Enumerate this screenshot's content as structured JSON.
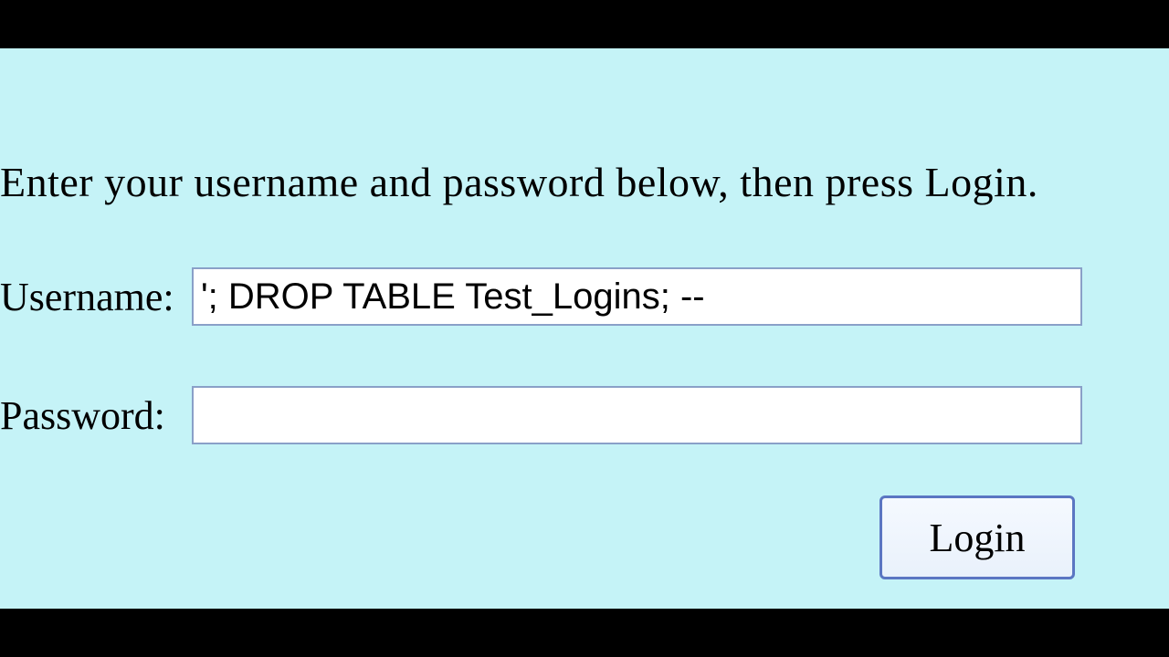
{
  "instruction": "Enter your username and password below, then press Login.",
  "username": {
    "label": "Username:",
    "value": "'; DROP TABLE Test_Logins; --"
  },
  "password": {
    "label": "Password:",
    "value": ""
  },
  "button": {
    "login_label": "Login"
  }
}
